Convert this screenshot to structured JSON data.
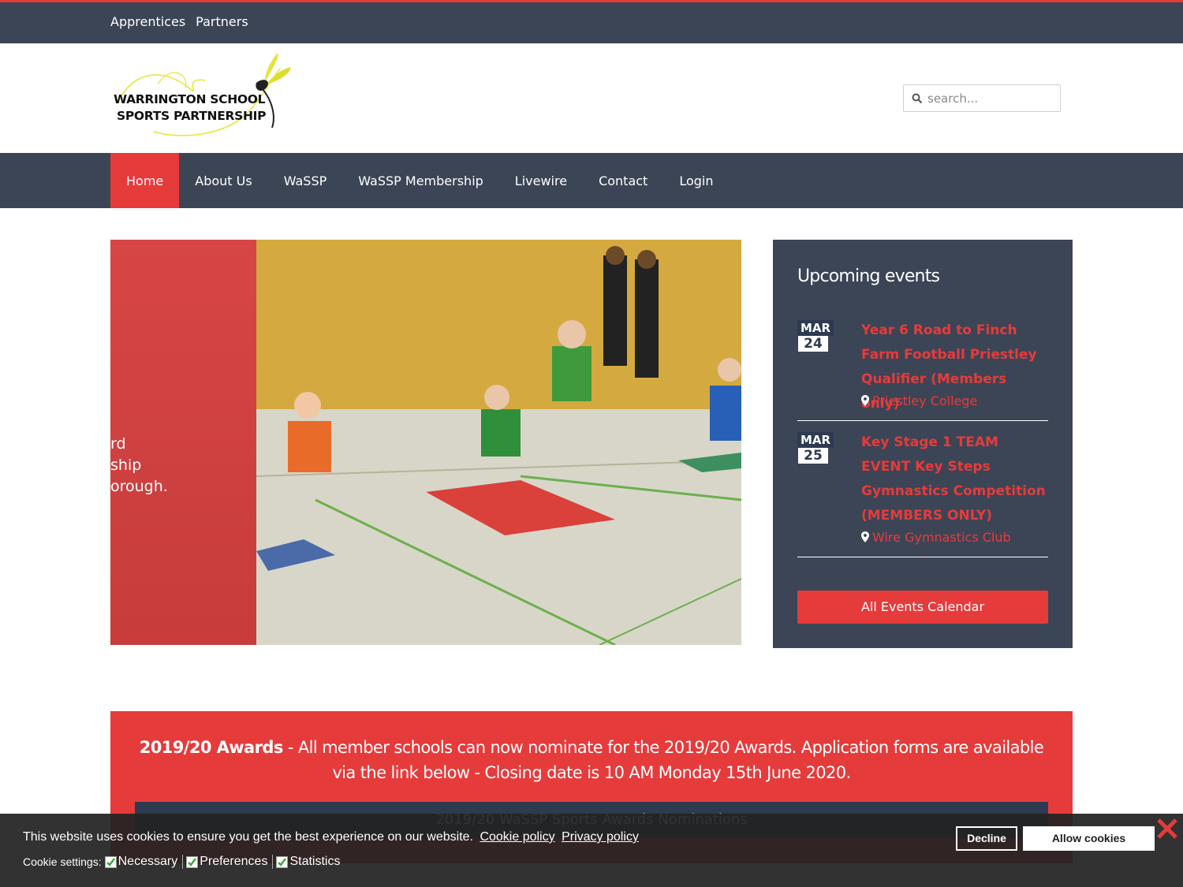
{
  "topbar": {
    "links": [
      "Apprentices",
      "Partners"
    ]
  },
  "header": {
    "logo_line1": "WARRINGTON SCHOOL",
    "logo_line2": "SPORTS PARTNERSHIP",
    "search_placeholder": "search..."
  },
  "nav": {
    "items": [
      "Home",
      "About Us",
      "WaSSP",
      "WaSSP Membership",
      "Livewire",
      "Contact",
      "Login"
    ]
  },
  "hero": {
    "overlay_lines": [
      "rd",
      "ship",
      "orough."
    ]
  },
  "events": {
    "heading": "Upcoming events",
    "items": [
      {
        "month": "MAR",
        "day": "24",
        "title": "Year 6 Road to Finch Farm Football Priestley Qualifier (Members only)",
        "location": "Priestley College"
      },
      {
        "month": "MAR",
        "day": "25",
        "title": "Key Stage 1 TEAM EVENT Key Steps Gymnastics Competition (MEMBERS ONLY)",
        "location": "Wire Gymnastics Club"
      }
    ],
    "button_label": "All Events Calendar"
  },
  "awards": {
    "bold": "2019/20 Awards",
    "text": " - All member schools can now nominate for the 2019/20 Awards. Application forms are available via the link below - Closing date is 10 AM Monday 15th June 2020.",
    "button_label": "2019/20 WaSSP Sports Awards Nominations"
  },
  "cookie": {
    "message": "This website uses cookies to ensure you get the best experience on our website.",
    "cookie_policy": "Cookie policy",
    "privacy_policy": "Privacy policy",
    "settings_label": "Cookie settings:",
    "options": [
      "Necessary",
      "Preferences",
      "Statistics"
    ],
    "decline": "Decline",
    "allow": "Allow cookies"
  },
  "colors": {
    "brand_red": "#e63b3b",
    "navy": "#3c4556",
    "logo_yellow": "#e5e53a"
  }
}
